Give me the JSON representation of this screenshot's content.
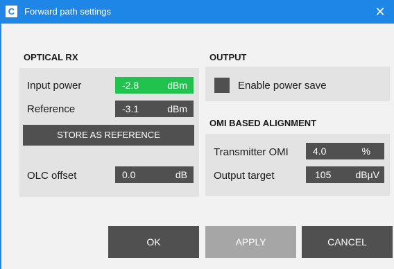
{
  "window": {
    "icon_letter": "C",
    "title": "Forward path settings",
    "close_glyph": "✕"
  },
  "optical_rx": {
    "header": "OPTICAL RX",
    "input_power": {
      "label": "Input power",
      "value": "-2.8",
      "unit": "dBm",
      "status_color": "#22c24e"
    },
    "reference": {
      "label": "Reference",
      "value": "-3.1",
      "unit": "dBm"
    },
    "store_button": "STORE AS REFERENCE",
    "olc_offset": {
      "label": "OLC offset",
      "value": "0.0",
      "unit": "dB"
    }
  },
  "output": {
    "header": "OUTPUT",
    "power_save": {
      "label": "Enable power save",
      "checked": false
    }
  },
  "omi": {
    "header": "OMI BASED ALIGNMENT",
    "transmitter_omi": {
      "label": "Transmitter OMI",
      "value": "4.0",
      "unit": "%"
    },
    "output_target": {
      "label": "Output target",
      "value": "105",
      "unit": "dBµV"
    }
  },
  "buttons": {
    "ok": "OK",
    "apply": "APPLY",
    "cancel": "CANCEL"
  },
  "colors": {
    "titlebar": "#1e86e6",
    "field": "#505050",
    "ok_value": "#22c24e",
    "disabled_button": "#a6a6a6"
  }
}
